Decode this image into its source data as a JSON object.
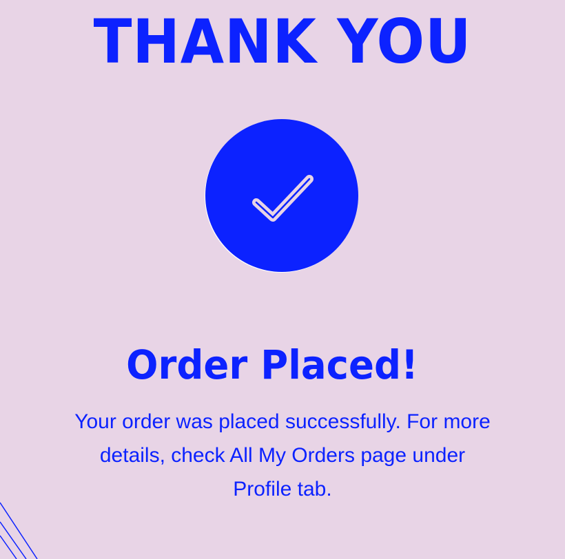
{
  "header": {
    "title": "THANK YOU"
  },
  "status": {
    "icon": "check-icon",
    "heading": "Order Placed!",
    "message": "Your order was placed successfully. For more details, check All My Orders page under Profile tab."
  },
  "colors": {
    "background": "#e8d4e6",
    "accent": "#0c22ff"
  }
}
